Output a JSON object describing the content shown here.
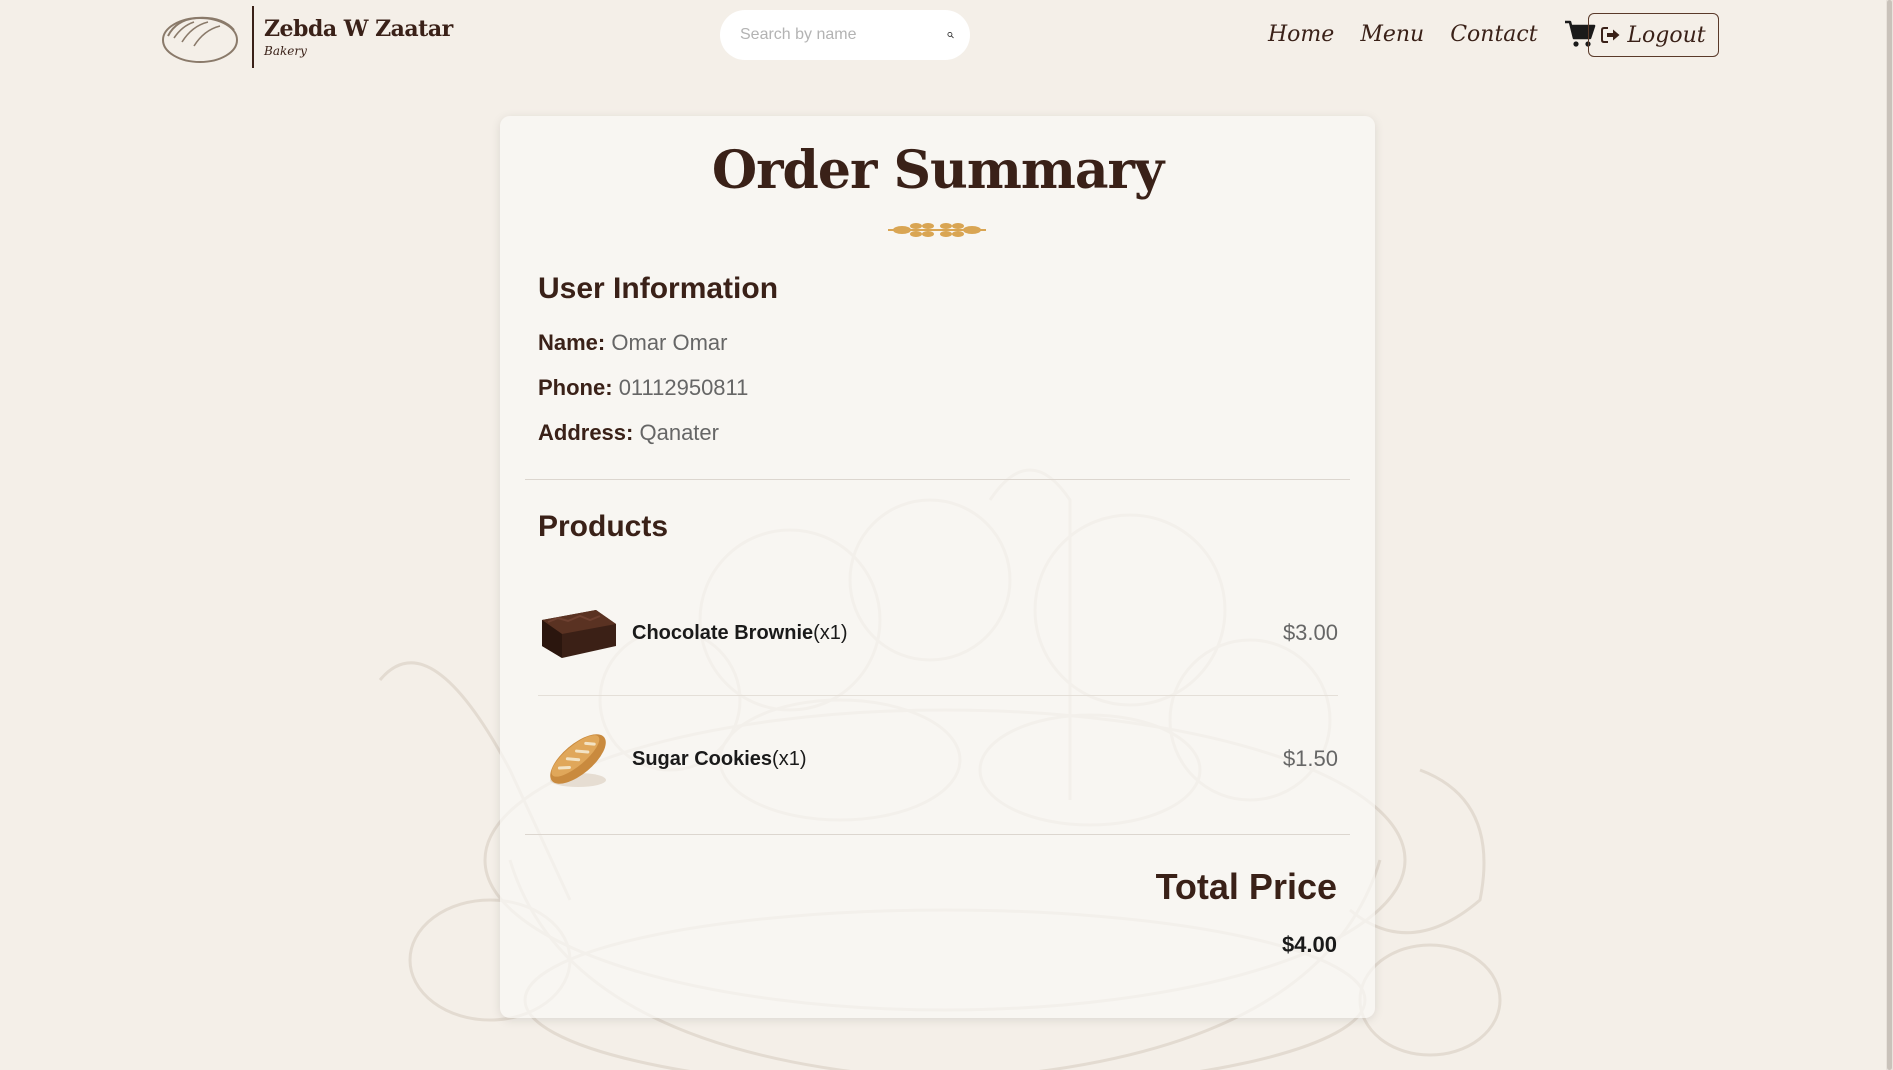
{
  "brand": {
    "name": "Zebda W Zaatar",
    "subtitle": "Bakery"
  },
  "search": {
    "placeholder": "Search by name",
    "value": ""
  },
  "nav": {
    "home": "Home",
    "menu": "Menu",
    "contact": "Contact",
    "logout": "Logout"
  },
  "order": {
    "title": "Order Summary",
    "user_heading": "User Information",
    "name_label": "Name:",
    "name_value": "Omar Omar",
    "phone_label": "Phone:",
    "phone_value": "01112950811",
    "address_label": "Address:",
    "address_value": "Qanater",
    "products_heading": "Products",
    "products": [
      {
        "name": "Chocolate Brownie",
        "qty": "(x1)",
        "price": "$3.00",
        "image": "brownie"
      },
      {
        "name": "Sugar Cookies",
        "qty": "(x1)",
        "price": "$1.50",
        "image": "bread-roll"
      }
    ],
    "total_label": "Total Price",
    "total_value": "$4.00"
  },
  "icons": {
    "logo": "bread-icon",
    "search": "search-icon",
    "cart": "cart-icon",
    "logout": "logout-icon",
    "divider": "wheat-divider-icon"
  },
  "colors": {
    "primary": "#3a2118",
    "background": "#f4efe8",
    "card": "#faf8f5",
    "muted": "#666666",
    "accent": "#d9a553"
  }
}
